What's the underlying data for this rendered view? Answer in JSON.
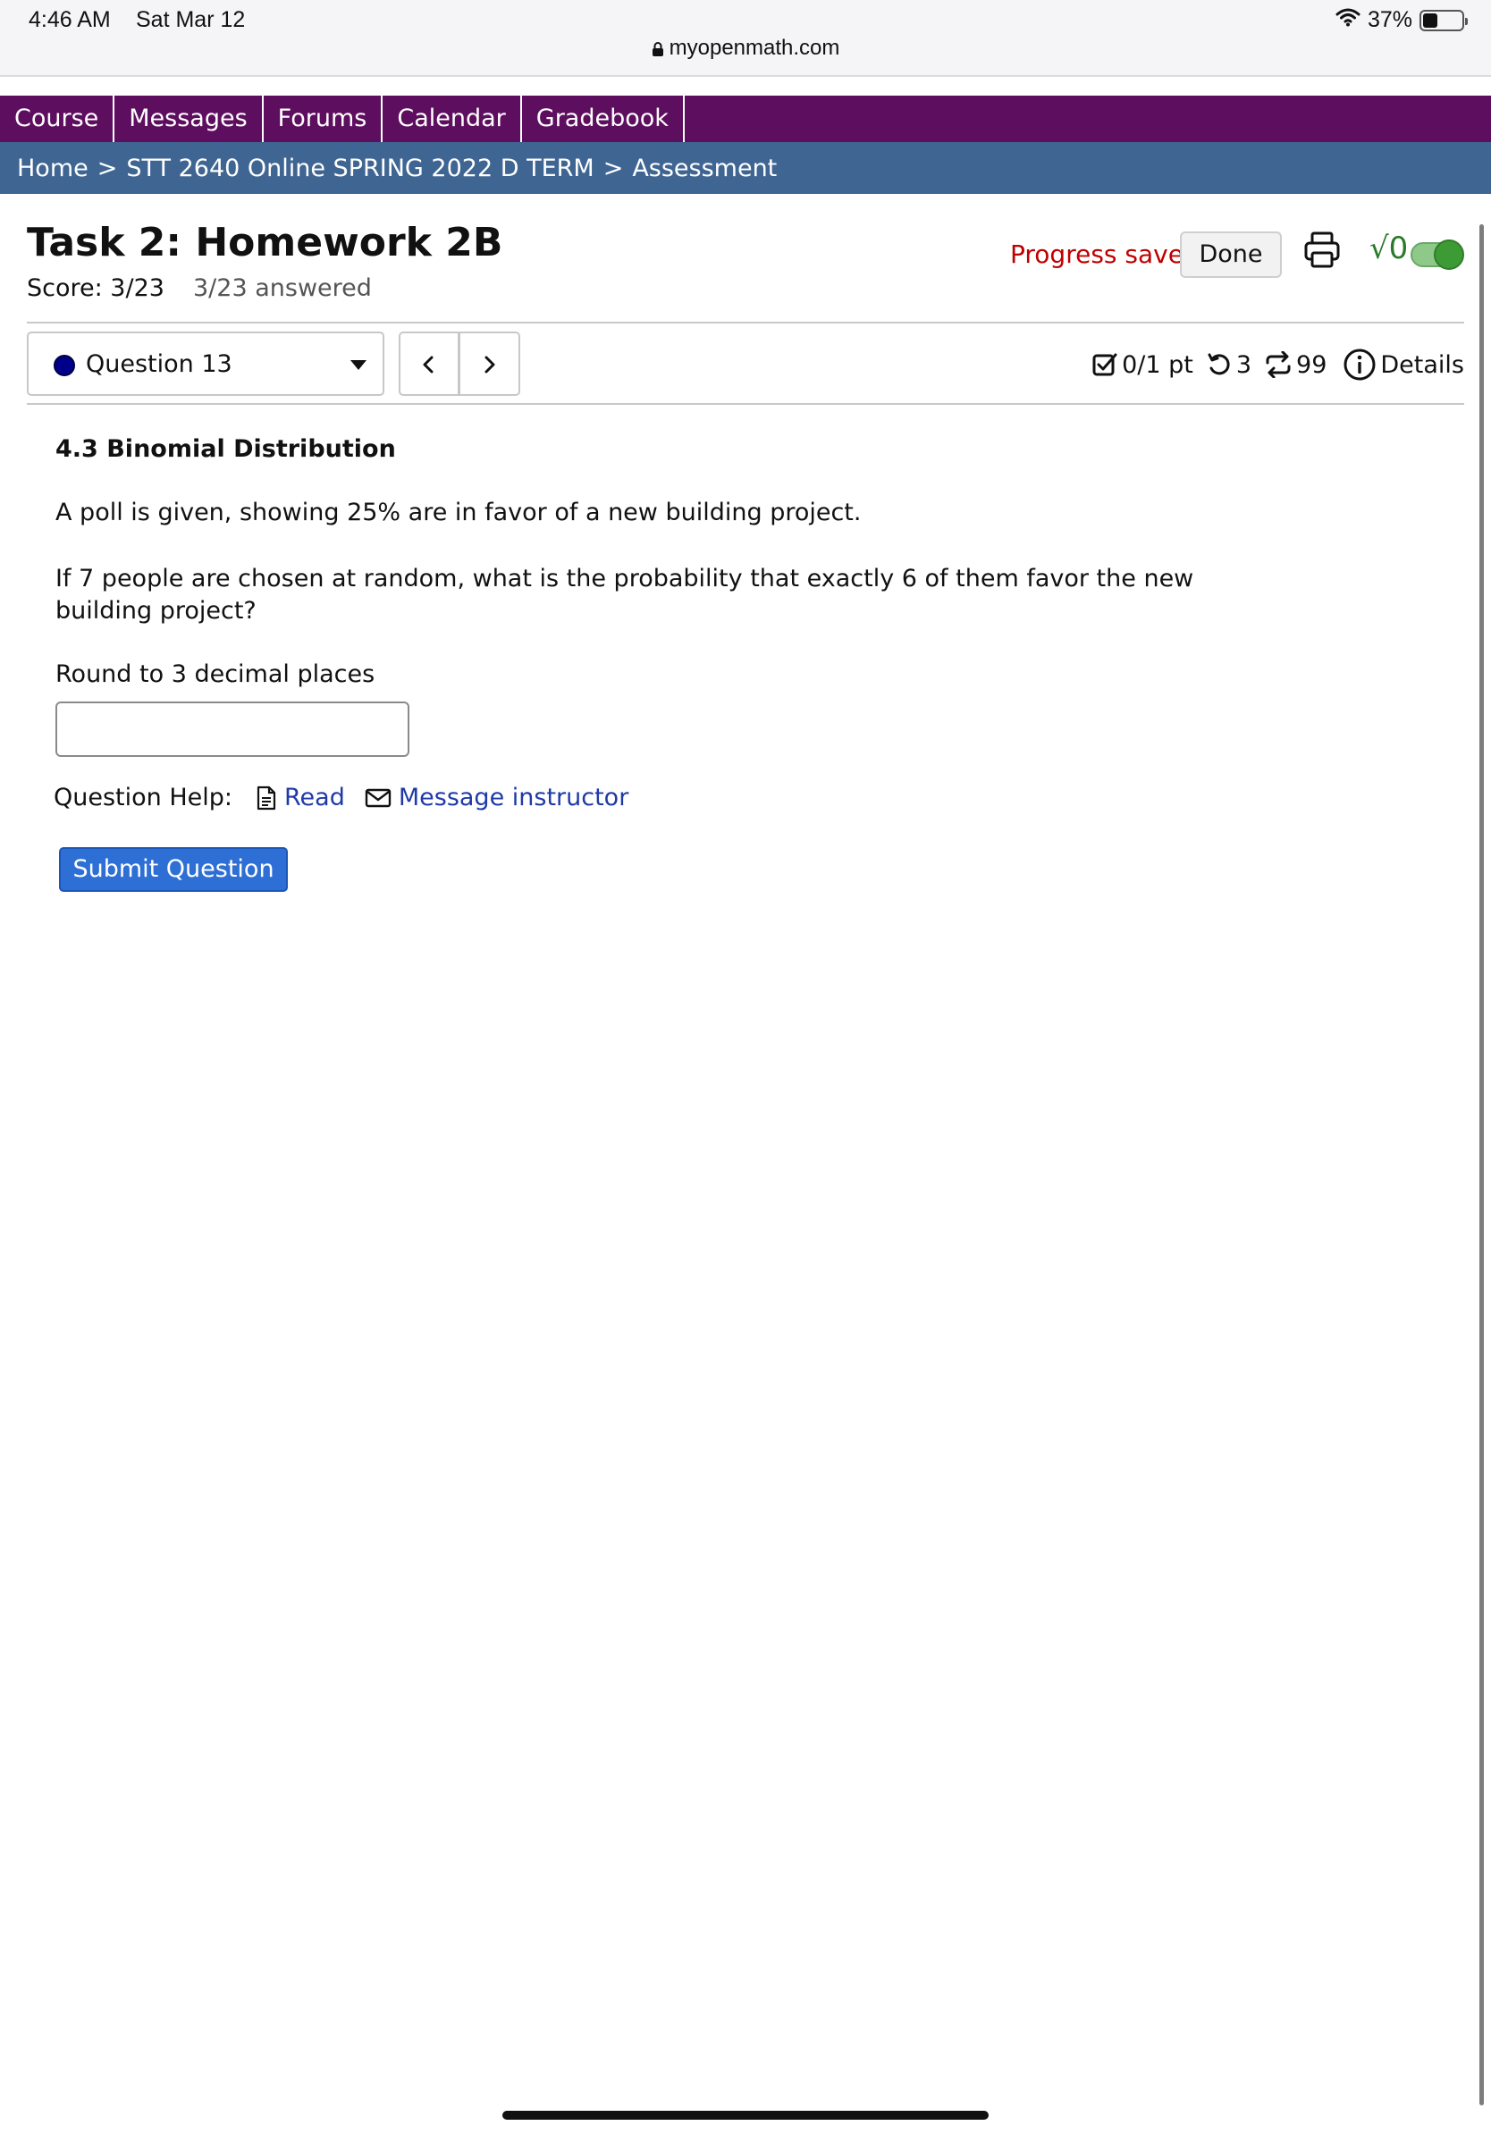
{
  "status_bar": {
    "time": "4:46 AM",
    "date": "Sat Mar 12",
    "url": "myopenmath.com",
    "battery": "37%",
    "battery_level": 0.37
  },
  "nav": {
    "items": [
      "Course",
      "Messages",
      "Forums",
      "Calendar",
      "Gradebook"
    ]
  },
  "breadcrumb": {
    "home": "Home",
    "course": "STT 2640 Online SPRING 2022 D TERM",
    "current": "Assessment",
    "separator": ">"
  },
  "header": {
    "title": "Task 2: Homework 2B",
    "score": "Score: 3/23",
    "answered": "3/23 answered",
    "progress_saved": "Progress saved",
    "done_label": "Done",
    "sqrt_label": "√0"
  },
  "question_nav": {
    "selected": "Question 13",
    "points": "0/1 pt",
    "retries": "3",
    "versions": "99",
    "details_label": "Details"
  },
  "question": {
    "section": "4.3 Binomial Distribution",
    "text1": "A poll is given, showing 25% are in favor of a new building project.",
    "text2": "If 7 people are chosen at random, what is the probability that exactly 6 of them favor the new building project?",
    "text3": "Round to 3 decimal places",
    "answer_value": ""
  },
  "help": {
    "label": "Question Help:",
    "read": "Read",
    "message": "Message instructor"
  },
  "submit_label": "Submit Question",
  "colors": {
    "nav_bg": "#5d0e5e",
    "breadcrumb_bg": "#3f6593",
    "progress_saved": "#c00000",
    "link": "#1f3aa8",
    "submit_bg": "#2e6fd6",
    "toggle": "#3d9b35"
  },
  "icons": [
    "lock-icon",
    "wifi-icon",
    "battery-icon",
    "print-icon",
    "sqrt-icon",
    "chevron-left-icon",
    "chevron-right-icon",
    "checkbox-icon",
    "retry-icon",
    "versions-icon",
    "info-icon",
    "document-icon",
    "mail-icon"
  ]
}
